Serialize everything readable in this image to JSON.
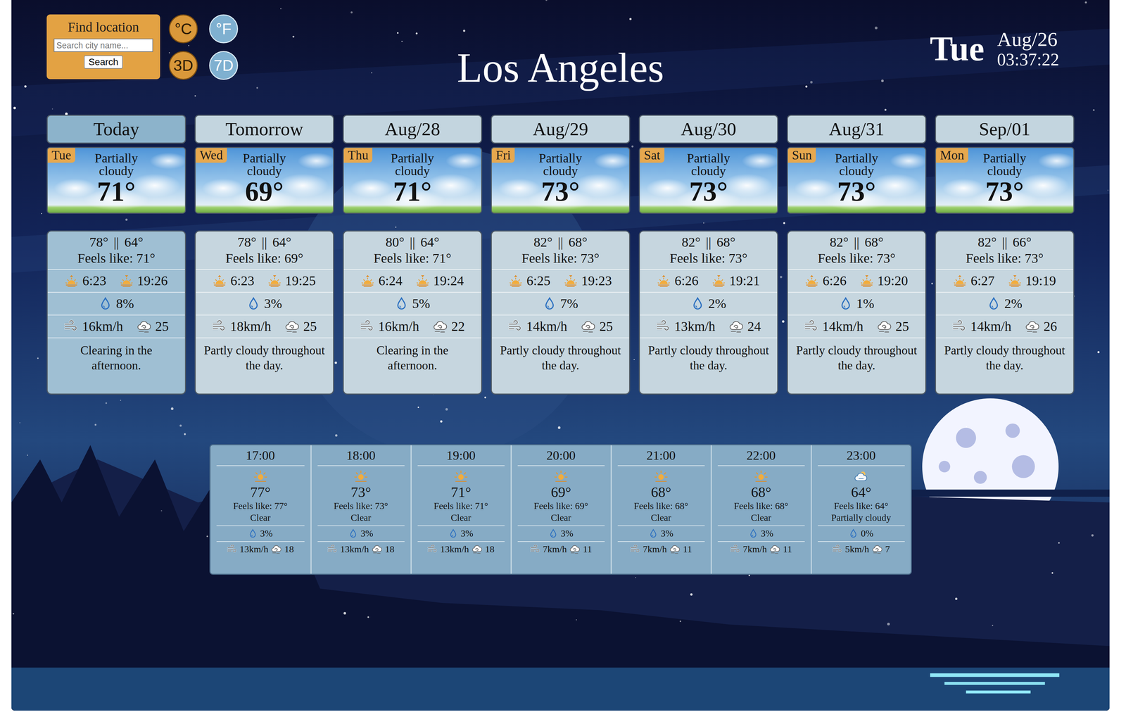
{
  "search": {
    "title": "Find location",
    "placeholder": "Search city name...",
    "button": "Search"
  },
  "units": [
    {
      "label": "°C",
      "selected": false
    },
    {
      "label": "°F",
      "selected": true
    }
  ],
  "ranges": [
    {
      "label": "3D",
      "selected": false
    },
    {
      "label": "7D",
      "selected": true
    }
  ],
  "city": "Los Angeles",
  "clock": {
    "weekday": "Tue",
    "date": "Aug/26",
    "time": "03:37:22"
  },
  "days": [
    {
      "label": "Today",
      "selected": true,
      "weekday": "Tue",
      "condition": "Partially cloudy",
      "temp": "71°",
      "high": "78°",
      "separator": "||",
      "low": "64°",
      "feels": "Feels like: 71°",
      "sunrise": "6:23",
      "sunset": "19:26",
      "precip": "8%",
      "wind": "16km/h",
      "gust": "25",
      "summary": "Clearing in the afternoon."
    },
    {
      "label": "Tomorrow",
      "selected": false,
      "weekday": "Wed",
      "condition": "Partially cloudy",
      "temp": "69°",
      "high": "78°",
      "separator": "||",
      "low": "64°",
      "feels": "Feels like: 69°",
      "sunrise": "6:23",
      "sunset": "19:25",
      "precip": "3%",
      "wind": "18km/h",
      "gust": "25",
      "summary": "Partly cloudy throughout the day."
    },
    {
      "label": "Aug/28",
      "selected": false,
      "weekday": "Thu",
      "condition": "Partially cloudy",
      "temp": "71°",
      "high": "80°",
      "separator": "||",
      "low": "64°",
      "feels": "Feels like: 71°",
      "sunrise": "6:24",
      "sunset": "19:24",
      "precip": "5%",
      "wind": "16km/h",
      "gust": "22",
      "summary": "Clearing in the afternoon."
    },
    {
      "label": "Aug/29",
      "selected": false,
      "weekday": "Fri",
      "condition": "Partially cloudy",
      "temp": "73°",
      "high": "82°",
      "separator": "||",
      "low": "68°",
      "feels": "Feels like: 73°",
      "sunrise": "6:25",
      "sunset": "19:23",
      "precip": "7%",
      "wind": "14km/h",
      "gust": "25",
      "summary": "Partly cloudy throughout the day."
    },
    {
      "label": "Aug/30",
      "selected": false,
      "weekday": "Sat",
      "condition": "Partially cloudy",
      "temp": "73°",
      "high": "82°",
      "separator": "||",
      "low": "68°",
      "feels": "Feels like: 73°",
      "sunrise": "6:26",
      "sunset": "19:21",
      "precip": "2%",
      "wind": "13km/h",
      "gust": "24",
      "summary": "Partly cloudy throughout the day."
    },
    {
      "label": "Aug/31",
      "selected": false,
      "weekday": "Sun",
      "condition": "Partially cloudy",
      "temp": "73°",
      "high": "82°",
      "separator": "||",
      "low": "68°",
      "feels": "Feels like: 73°",
      "sunrise": "6:26",
      "sunset": "19:20",
      "precip": "1%",
      "wind": "14km/h",
      "gust": "25",
      "summary": "Partly cloudy throughout the day."
    },
    {
      "label": "Sep/01",
      "selected": false,
      "weekday": "Mon",
      "condition": "Partially cloudy",
      "temp": "73°",
      "high": "82°",
      "separator": "||",
      "low": "66°",
      "feels": "Feels like: 73°",
      "sunrise": "6:27",
      "sunset": "19:19",
      "precip": "2%",
      "wind": "14km/h",
      "gust": "26",
      "summary": "Partly cloudy throughout the day."
    }
  ],
  "hours": [
    {
      "time": "17:00",
      "kind": "sun",
      "temp": "77°",
      "feels": "Feels like: 77°",
      "condition": "Clear",
      "precip": "3%",
      "wind": "13km/h",
      "gust": "18"
    },
    {
      "time": "18:00",
      "kind": "sun",
      "temp": "73°",
      "feels": "Feels like: 73°",
      "condition": "Clear",
      "precip": "3%",
      "wind": "13km/h",
      "gust": "18"
    },
    {
      "time": "19:00",
      "kind": "sun",
      "temp": "71°",
      "feels": "Feels like: 71°",
      "condition": "Clear",
      "precip": "3%",
      "wind": "13km/h",
      "gust": "18"
    },
    {
      "time": "20:00",
      "kind": "sun",
      "temp": "69°",
      "feels": "Feels like: 69°",
      "condition": "Clear",
      "precip": "3%",
      "wind": "7km/h",
      "gust": "11"
    },
    {
      "time": "21:00",
      "kind": "sun",
      "temp": "68°",
      "feels": "Feels like: 68°",
      "condition": "Clear",
      "precip": "3%",
      "wind": "7km/h",
      "gust": "11"
    },
    {
      "time": "22:00",
      "kind": "sun",
      "temp": "68°",
      "feels": "Feels like: 68°",
      "condition": "Clear",
      "precip": "3%",
      "wind": "7km/h",
      "gust": "11"
    },
    {
      "time": "23:00",
      "kind": "cloudy",
      "temp": "64°",
      "feels": "Feels like: 64°",
      "condition": "Partially cloudy",
      "precip": "0%",
      "wind": "5km/h",
      "gust": "7"
    }
  ]
}
